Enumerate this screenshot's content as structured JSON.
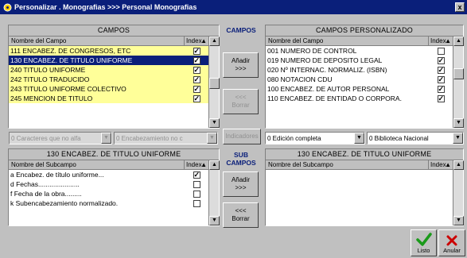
{
  "window": {
    "title": "Personalizar . Monografias >>> Personal Monografias",
    "close_glyph": "x"
  },
  "campos": {
    "heading": "CAMPOS",
    "col_name": "Nombre del Campo",
    "col_index": "Index",
    "rows": [
      {
        "name": "111 ENCABEZ. DE CONGRESOS, ETC",
        "checked": true,
        "style": "yellow"
      },
      {
        "name": "130 ENCABEZ. DE TITULO UNIFORME",
        "checked": true,
        "style": "sel"
      },
      {
        "name": "240 TITULO UNIFORME",
        "checked": true,
        "style": "yellow"
      },
      {
        "name": "242 TITULO TRADUCIDO",
        "checked": true,
        "style": "yellow"
      },
      {
        "name": "243 TITULO UNIFORME COLECTIVO",
        "checked": true,
        "style": "yellow"
      },
      {
        "name": "245 MENCION DE TITULO",
        "checked": true,
        "style": "yellow"
      }
    ]
  },
  "mid_top": {
    "label": "CAMPOS",
    "add_label": "Añadir",
    "add_arrow": ">>>",
    "remove_arrow": "<<<",
    "remove_label": "Borrar",
    "indicadores_label": "Indicadores"
  },
  "personalizado": {
    "heading": "CAMPOS PERSONALIZADO",
    "col_name": "Nombre del Campo",
    "col_index": "Index",
    "rows": [
      {
        "name": "001 NUMERO DE CONTROL",
        "checked": false
      },
      {
        "name": "019 NUMERO DE DEPOSITO LEGAL",
        "checked": true
      },
      {
        "name": "020 Nº INTERNAC. NORMALIZ. (ISBN)",
        "checked": true
      },
      {
        "name": "080 NOTACION CDU",
        "checked": true
      },
      {
        "name": "100 ENCABEZ. DE AUTOR PERSONAL",
        "checked": true
      },
      {
        "name": "110 ENCABEZ. DE ENTIDAD O CORPORA.",
        "checked": true
      }
    ]
  },
  "combos": {
    "left1": "0 Caracteres que no alfa",
    "left2": "0 Encabezamiento no c",
    "right1": "0 Edición completa",
    "right2": "0 Biblioteca Nacional"
  },
  "subcampos": {
    "heading": "130 ENCABEZ. DE TITULO UNIFORME",
    "col_name": "Nombre del Subcampo",
    "col_index": "Index",
    "rows": [
      {
        "name": "a Encabez. de título uniforme...",
        "checked": true
      },
      {
        "name": "d Fechas......................",
        "checked": false
      },
      {
        "name": "f Fecha de la obra.........",
        "checked": false
      },
      {
        "name": "k Subencabezamiento normalizado.",
        "checked": false
      }
    ]
  },
  "mid_bottom": {
    "label1": "SUB",
    "label2": "CAMPOS",
    "add_label": "Añadir",
    "add_arrow": ">>>",
    "remove_arrow": "<<<",
    "remove_label": "Borrar"
  },
  "subcampos_personalizado": {
    "heading": "130 ENCABEZ. DE TITULO UNIFORME",
    "col_name": "Nombre del Subcampo",
    "col_index": "Index"
  },
  "footer": {
    "ok_label": "Listo",
    "cancel_label": "Anular"
  },
  "colors": {
    "title_bg": "#0a1f7a",
    "row_yellow": "#ffff99",
    "ok_green": "#1a9a1a",
    "cancel_red": "#cc0000"
  }
}
